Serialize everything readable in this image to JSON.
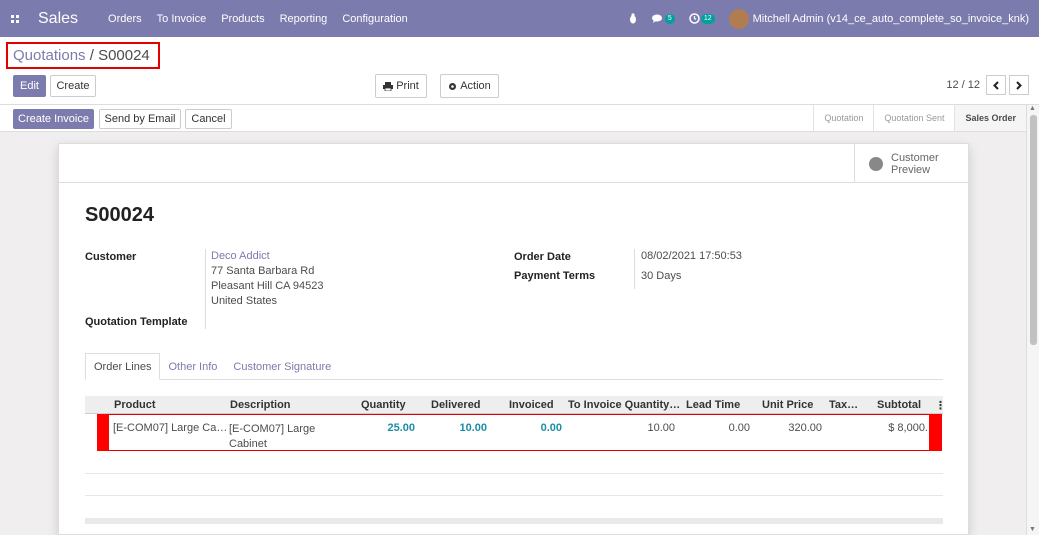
{
  "navbar": {
    "app_name": "Sales",
    "menu": [
      "Orders",
      "To Invoice",
      "Products",
      "Reporting",
      "Configuration"
    ],
    "bug_icon": "bug-icon",
    "chat_badge": "5",
    "activity_badge": "12",
    "user": "Mitchell Admin (v14_ce_auto_complete_so_invoice_knk)"
  },
  "breadcrumb": {
    "parent": "Quotations",
    "separator": " / ",
    "current": "S00024"
  },
  "toolbar": {
    "edit": "Edit",
    "create": "Create",
    "print": "Print",
    "action": "Action"
  },
  "pager": {
    "value": "12 / 12"
  },
  "status_buttons": {
    "create_invoice": "Create Invoice",
    "send_email": "Send by Email",
    "cancel": "Cancel"
  },
  "stages": [
    "Quotation",
    "Quotation Sent",
    "Sales Order"
  ],
  "stage_active": "Sales Order",
  "smart_button": {
    "line1": "Customer",
    "line2": "Preview"
  },
  "record": {
    "name": "S00024",
    "customer_label": "Customer",
    "customer_name": "Deco Addict",
    "address_lines": [
      "77 Santa Barbara Rd",
      "Pleasant Hill CA 94523",
      "United States"
    ],
    "template_label": "Quotation Template",
    "order_date_label": "Order Date",
    "order_date": "08/02/2021 17:50:53",
    "payment_terms_label": "Payment Terms",
    "payment_terms": "30 Days"
  },
  "tabs": [
    "Order Lines",
    "Other Info",
    "Customer Signature"
  ],
  "columns": [
    "Product",
    "Description",
    "Quantity",
    "Delivered",
    "Invoiced",
    "To Invoice Quantity…",
    "Lead Time",
    "Unit Price",
    "Tax…",
    "Subtotal"
  ],
  "rows": [
    {
      "product": "[E-COM07] Large Ca…",
      "description_1": "[E-COM07] Large",
      "description_2": "Cabinet",
      "quantity": "25.00",
      "delivered": "10.00",
      "invoiced": "0.00",
      "to_invoice": "10.00",
      "lead_time": "0.00",
      "unit_price": "320.00",
      "subtotal": "$ 8,000."
    }
  ],
  "colors": {
    "brand": "#7c7bad",
    "highlight": "#e50000",
    "qty_blue": "#1b8ea5"
  }
}
